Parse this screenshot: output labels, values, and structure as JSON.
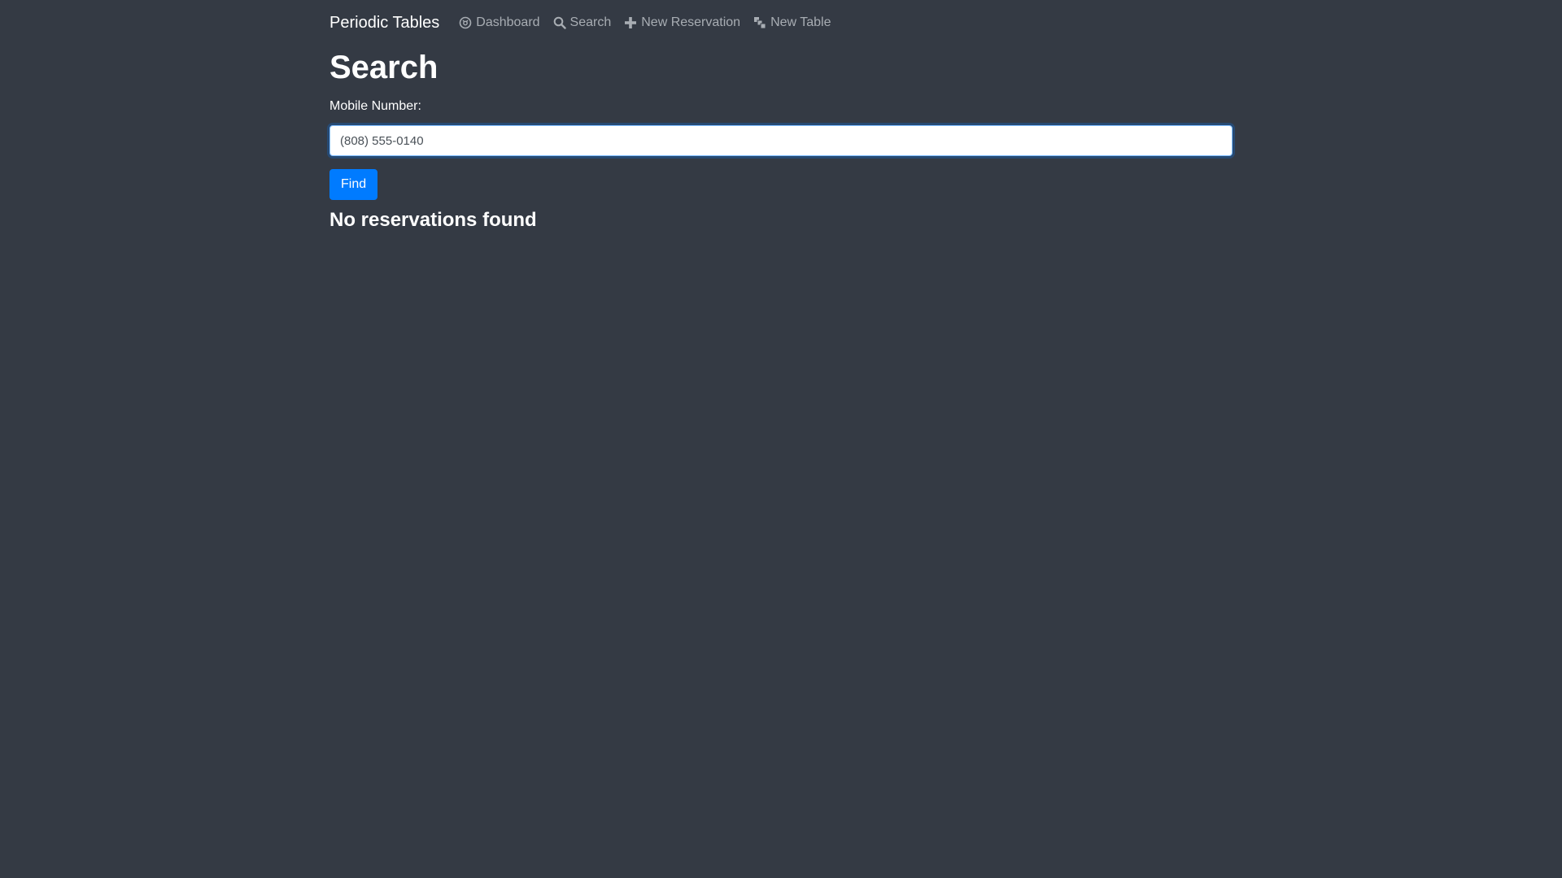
{
  "navbar": {
    "brand": "Periodic Tables",
    "links": [
      {
        "label": "Dashboard",
        "icon": "dashboard-icon"
      },
      {
        "label": "Search",
        "icon": "search-icon"
      },
      {
        "label": "New Reservation",
        "icon": "plus-icon"
      },
      {
        "label": "New Table",
        "icon": "table-icon"
      }
    ]
  },
  "page": {
    "title": "Search",
    "mobile_label": "Mobile Number:",
    "mobile_value": "(808) 555-0140",
    "find_label": "Find",
    "result_message": "No reservations found"
  },
  "colors": {
    "background": "#343a44",
    "nav_link": "#a8adb3",
    "primary": "#007bff"
  }
}
